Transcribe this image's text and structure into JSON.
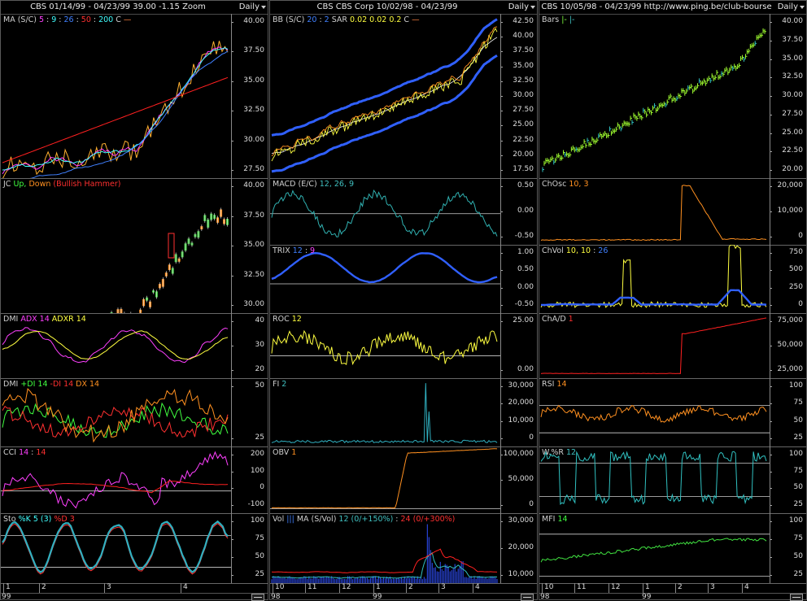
{
  "windows": [
    {
      "title": "CBS  01/14/99 - 04/23/99   39.00  -1.15   Zoom",
      "period": "Daily",
      "xticks": [
        "1",
        "2",
        "3",
        "4"
      ],
      "year": "99",
      "panels": [
        {
          "id": "ma",
          "labels": [
            [
              "MA (S/C)",
              "#cfcfcf"
            ],
            [
              "5",
              "#ff40ff"
            ],
            [
              ":",
              "#cfcfcf"
            ],
            [
              "9",
              "#40ffff"
            ],
            [
              ":",
              "#cfcfcf"
            ],
            [
              "26",
              "#4080ff"
            ],
            [
              ":",
              "#cfcfcf"
            ],
            [
              "50",
              "#ff3030"
            ],
            [
              ":",
              "#cfcfcf"
            ],
            [
              "200",
              "#40ffff"
            ],
            [
              "C",
              "#cfcfcf"
            ],
            [
              "—",
              "#ff8040"
            ]
          ],
          "yticks": [
            "40.00",
            "37.50",
            "35.00",
            "32.50",
            "30.00",
            "27.50"
          ]
        },
        {
          "id": "jc",
          "labels": [
            [
              "JC",
              "#cfcfcf"
            ],
            [
              "Up,",
              "#40ff40"
            ],
            [
              "Down",
              "#ff9020"
            ],
            [
              "(Bullish Hammer)",
              "#ff3030"
            ]
          ],
          "yticks": [
            "40.00",
            "37.50",
            "35.00",
            "32.50",
            "30.00"
          ]
        },
        {
          "id": "dmi1",
          "labels": [
            [
              "DMI",
              "#cfcfcf"
            ],
            [
              "ADX 14",
              "#ff40ff"
            ],
            [
              "ADXR 14",
              "#ffff40"
            ]
          ],
          "yticks": [
            "40",
            "30",
            "20"
          ]
        },
        {
          "id": "dmi2",
          "labels": [
            [
              "DMI",
              "#cfcfcf"
            ],
            [
              "+DI 14",
              "#40ff40"
            ],
            [
              "-DI 14",
              "#ff3030"
            ],
            [
              "DX 14",
              "#ff9020"
            ]
          ],
          "yticks": [
            "50",
            "25"
          ]
        },
        {
          "id": "cci",
          "labels": [
            [
              "CCI",
              "#cfcfcf"
            ],
            [
              "14",
              "#ff40ff"
            ],
            [
              ":",
              "#cfcfcf"
            ],
            [
              "14",
              "#ff3030"
            ]
          ],
          "yticks": [
            "200",
            "100",
            "0",
            "-100"
          ]
        },
        {
          "id": "sto",
          "labels": [
            [
              "Sto",
              "#cfcfcf"
            ],
            [
              "%K 5 (3)",
              "#40ffff"
            ],
            [
              "%D 3",
              "#ff3030"
            ]
          ],
          "yticks": [
            "100",
            "75",
            "50",
            "25"
          ]
        }
      ]
    },
    {
      "title": "CBS  CBS Corp  10/02/98 - 04/23/99",
      "period": "Daily",
      "xticks": [
        "10",
        "11",
        "12",
        "1",
        "2",
        "3",
        "4"
      ],
      "year": "98",
      "year2": "99",
      "panels": [
        {
          "id": "bb",
          "labels": [
            [
              "BB (S/C)",
              "#cfcfcf"
            ],
            [
              "20",
              "#4080ff"
            ],
            [
              ":",
              "#cfcfcf"
            ],
            [
              "2",
              "#4080ff"
            ],
            [
              "SAR",
              "#cfcfcf"
            ],
            [
              "0.02",
              "#ffff40"
            ],
            [
              "0.02",
              "#ffff40"
            ],
            [
              "0.2",
              "#ffff40"
            ],
            [
              "C",
              "#cfcfcf"
            ],
            [
              "—",
              "#ff8040"
            ]
          ],
          "yticks": [
            "42.50",
            "40.00",
            "37.50",
            "35.00",
            "32.50",
            "30.00",
            "27.50",
            "25.00",
            "22.50",
            "20.00",
            "17.50"
          ]
        },
        {
          "id": "macd",
          "labels": [
            [
              "MACD (E/C)",
              "#cfcfcf"
            ],
            [
              "12, 26, 9",
              "#40c0c0"
            ]
          ],
          "yticks": [
            "0.50",
            "0.00",
            "-0.50"
          ]
        },
        {
          "id": "trix",
          "labels": [
            [
              "TRIX",
              "#cfcfcf"
            ],
            [
              "12",
              "#4080ff"
            ],
            [
              ":",
              "#cfcfcf"
            ],
            [
              "9",
              "#ff40ff"
            ]
          ],
          "yticks": [
            "1.00",
            "0.50",
            "0.00",
            "-0.50"
          ]
        },
        {
          "id": "roc",
          "labels": [
            [
              "ROC",
              "#cfcfcf"
            ],
            [
              "12",
              "#ffff40"
            ]
          ],
          "yticks": [
            "25.00",
            "0.00"
          ]
        },
        {
          "id": "fi",
          "labels": [
            [
              "FI",
              "#cfcfcf"
            ],
            [
              "2",
              "#40c0c0"
            ]
          ],
          "yticks": [
            "30,000",
            "20,000",
            "10,000",
            "0"
          ]
        },
        {
          "id": "obv",
          "labels": [
            [
              "OBV",
              "#cfcfcf"
            ],
            [
              "1",
              "#ff9020"
            ]
          ],
          "yticks": [
            "100,000",
            "50,000",
            "0"
          ]
        },
        {
          "id": "vol",
          "labels": [
            [
              "Vol",
              "#cfcfcf"
            ],
            [
              "|||",
              "#4080ff"
            ],
            [
              "MA (S/Vol)",
              "#cfcfcf"
            ],
            [
              "12 (0/+150%)",
              "#40c0c0"
            ],
            [
              ":",
              "#cfcfcf"
            ],
            [
              "24 (0/+300%)",
              "#ff3030"
            ]
          ],
          "yticks": [
            "30,000",
            "20,000",
            "10,000"
          ]
        }
      ]
    },
    {
      "title": "CBS  10/05/98 - 04/23/99   http://www.ping.be/club-bourse",
      "period": "Daily",
      "xticks": [
        "10",
        "11",
        "12",
        "1",
        "2",
        "3",
        "4"
      ],
      "year": "98",
      "year2": "99",
      "panels": [
        {
          "id": "bars",
          "labels": [
            [
              "Bars",
              "#cfcfcf"
            ],
            [
              "|-",
              "#80ff40"
            ],
            [
              "|-",
              "#40c0c0"
            ]
          ],
          "yticks": [
            "40.00",
            "37.50",
            "35.00",
            "32.50",
            "30.00",
            "27.50",
            "25.00",
            "22.50",
            "20.00"
          ]
        },
        {
          "id": "chosc",
          "labels": [
            [
              "ChOsc",
              "#cfcfcf"
            ],
            [
              "10, 3",
              "#ff9020"
            ]
          ],
          "yticks": [
            "20,000",
            "10,000",
            "0"
          ]
        },
        {
          "id": "chvol",
          "labels": [
            [
              "ChVol",
              "#cfcfcf"
            ],
            [
              "10, 10",
              "#ffff40"
            ],
            [
              ":",
              "#cfcfcf"
            ],
            [
              "26",
              "#4080ff"
            ]
          ],
          "yticks": [
            "750",
            "500",
            "250",
            "0"
          ]
        },
        {
          "id": "chad",
          "labels": [
            [
              "ChA/D",
              "#cfcfcf"
            ],
            [
              "1",
              "#ff3030"
            ]
          ],
          "yticks": [
            "75,000",
            "50,000",
            "25,000"
          ]
        },
        {
          "id": "rsi",
          "labels": [
            [
              "RSI",
              "#cfcfcf"
            ],
            [
              "14",
              "#ff9020"
            ]
          ],
          "yticks": [
            "100",
            "75",
            "50",
            "25"
          ]
        },
        {
          "id": "wr",
          "labels": [
            [
              "W.%R",
              "#cfcfcf"
            ],
            [
              "12",
              "#40c0c0"
            ]
          ],
          "yticks": [
            "100",
            "75",
            "50",
            "25"
          ]
        },
        {
          "id": "mfi",
          "labels": [
            [
              "MFI",
              "#cfcfcf"
            ],
            [
              "14",
              "#40ff40"
            ]
          ],
          "yticks": [
            "100",
            "75",
            "50",
            "25"
          ]
        }
      ]
    }
  ]
}
